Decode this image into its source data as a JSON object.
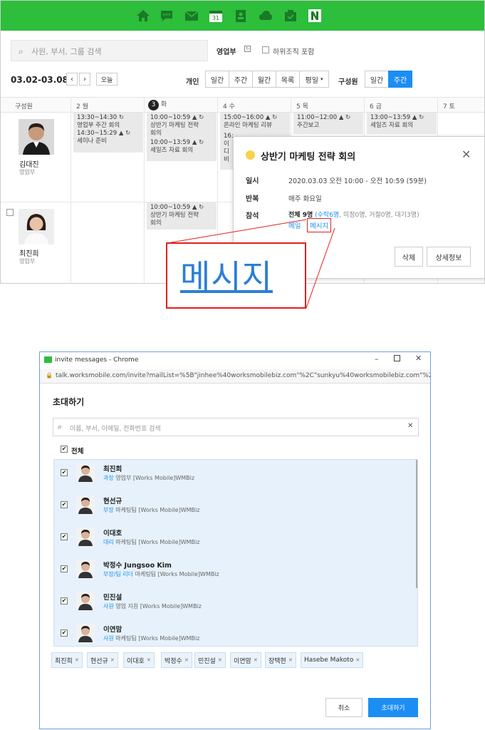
{
  "calendar": {
    "search_placeholder": "사원, 부서, 그룹 검색",
    "dept_filter": "영업부",
    "include_sub_label": "하위조직 포함",
    "date_range": "03.02-03.08",
    "today_label": "오늘",
    "personal_label": "개인",
    "view_buttons": [
      "일간",
      "주간",
      "월간",
      "목록",
      "평일"
    ],
    "members_label": "구성원",
    "member_view_buttons": [
      "일간",
      "주간"
    ],
    "members_col": "구성원",
    "days": [
      {
        "num": "2",
        "day": "월"
      },
      {
        "num": "3",
        "day": "화"
      },
      {
        "num": "4",
        "day": "수"
      },
      {
        "num": "5",
        "day": "목"
      },
      {
        "num": "6",
        "day": "금"
      },
      {
        "num": "7",
        "day": "토"
      }
    ],
    "people": [
      {
        "name": "김대진",
        "dept": "영업부"
      },
      {
        "name": "최진희",
        "dept": "영업부"
      }
    ],
    "events": {
      "e1": {
        "time": "13:30~14:30",
        "title": "영업부 주간 회의"
      },
      "e2": {
        "time": "14:30~15:29",
        "title": "세미나 준비"
      },
      "e3": {
        "time": "10:00~10:59",
        "title": "상반기 마케팅 전략 회의"
      },
      "e4": {
        "time": "10:00~13:59",
        "title": "세일즈 자료 회의"
      },
      "e5": {
        "time": "15:00~16:00",
        "title": "온라인 마케팅 리뷰"
      },
      "e6": {
        "time": "16:",
        "title": "이디비"
      },
      "e7": {
        "time": "11:00~12:00",
        "title": "주간보고"
      },
      "e8": {
        "time": "13:00~13:59",
        "title": "세일즈 자료 회의"
      },
      "e9": {
        "time": "10:00~10:59",
        "title": "상반기 마케팅 전략 회의"
      }
    }
  },
  "popup": {
    "title": "상반기 마케팅 전략 회의",
    "date_label": "일시",
    "date_value": "2020.03.03 오전 10:00 - 오전 10:59 (59분)",
    "repeat_label": "반복",
    "repeat_value": "매주 화요일",
    "attend_label": "참석",
    "attend_total": "전체 9명",
    "attend_accept": "(수락6명",
    "attend_rest": ", 미정0명, 거절0명, 대기3명)",
    "mail_link": "메일",
    "message_link": "메시지",
    "delete_btn": "삭제",
    "detail_btn": "상세정보"
  },
  "zoom_text": "메시지",
  "window": {
    "title": "invite messages - Chrome",
    "url": "talk.worksmobile.com/invite?mailList=%5B\"jinhee%40worksmobilebiz.com\"%2C\"sunkyu%40worksmobilebiz.com\"%2...",
    "heading": "초대하기",
    "search_placeholder": "이름, 부서, 이메일, 전화번호 검색",
    "select_all": "전체",
    "people": [
      {
        "name": "최진희",
        "title": "과장",
        "org": "영업부 [Works Mobile]WMBiz"
      },
      {
        "name": "현선규",
        "title": "부장",
        "org": "마케팅팀 [Works Mobile]WMBiz"
      },
      {
        "name": "이대호",
        "title": "대리",
        "org": "마케팅팀 [Works Mobile]WMBiz"
      },
      {
        "name": "박정수 Jungsoo Kim",
        "title": "부장/팀 리더",
        "org": "마케팅팀 [Works Mobile]WMBiz"
      },
      {
        "name": "민진설",
        "title": "사원",
        "org": "영업 지원 [Works Mobile]WMBiz"
      },
      {
        "name": "이연맘",
        "title": "사원",
        "org": "마케팅팀 [Works Mobile]WMBiz"
      }
    ],
    "chips": [
      "최진희",
      "현선규",
      "이대호",
      "박정수",
      "민진설",
      "이연맘",
      "장택현",
      "Hasebe Makoto"
    ],
    "cancel_btn": "취소",
    "invite_btn": "초대하기"
  },
  "colors": {
    "topbar": "#2dbe3c",
    "accent": "#1c8ef3",
    "highlight": "#e02020"
  }
}
